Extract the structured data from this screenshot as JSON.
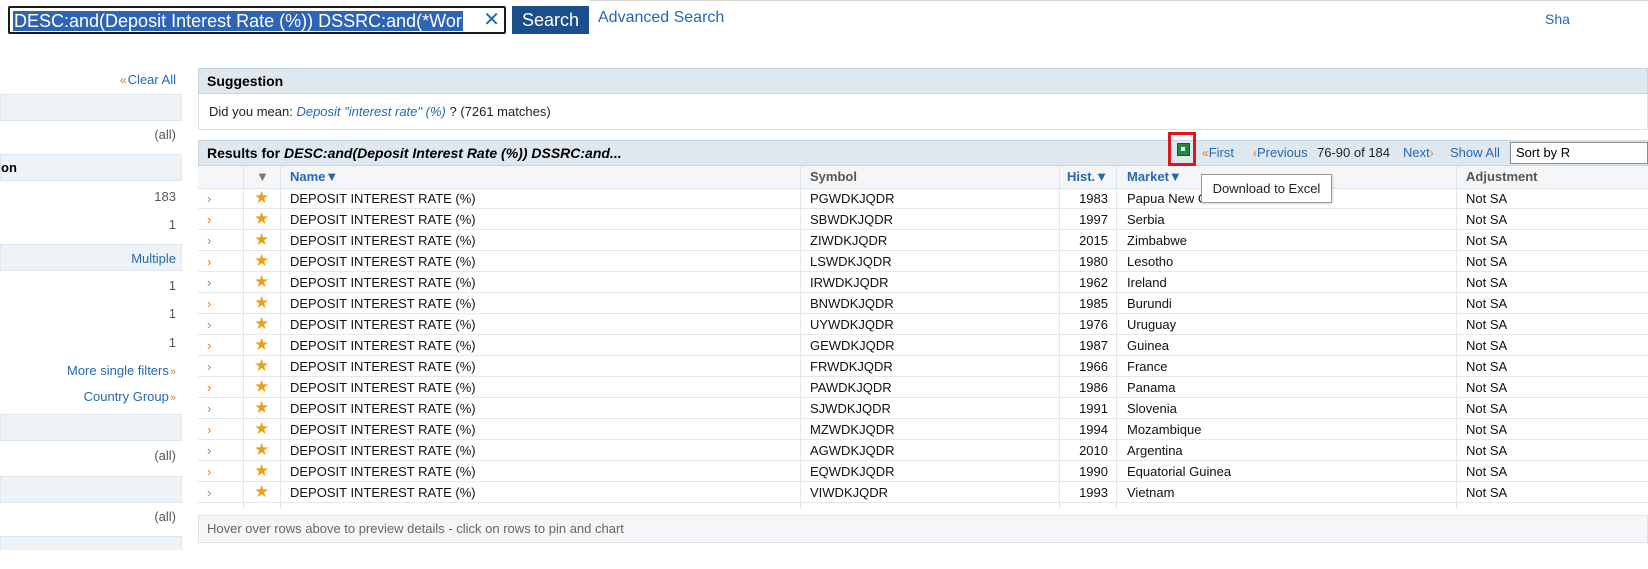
{
  "search": {
    "query": "DESC:and(Deposit Interest Rate (%)) DSSRC:and(*Wor",
    "button_label": "Search",
    "advanced_label": "Advanced Search",
    "share_label": "Sha"
  },
  "sidebar": {
    "clear_all": "Clear All",
    "section_on_label": "on",
    "values": [
      "(all)",
      "183",
      "1",
      "Multiple",
      "1",
      "1",
      "1",
      "(all)",
      "(all)"
    ],
    "more_filters": "More single filters",
    "country_group": "Country Group"
  },
  "suggestion": {
    "title": "Suggestion",
    "prefix": "Did you mean:",
    "link_text": "Deposit \"interest rate\" (%)",
    "suffix": "? (7261 matches)"
  },
  "results": {
    "label": "Results for",
    "query": "DESC:and(Deposit Interest Rate (%)) DSSRC:and...",
    "pager": {
      "first": "First",
      "previous": "Previous",
      "range": "76-90 of 184",
      "next": "Next",
      "show_all": "Show All",
      "sort_label": "Sort by R"
    },
    "tooltip": "Download to Excel",
    "columns": {
      "name": "Name",
      "symbol": "Symbol",
      "hist": "Hist.",
      "market": "Market",
      "adjustment": "Adjustment"
    },
    "rows": [
      {
        "name": "DEPOSIT INTEREST RATE (%)",
        "symbol": "PGWDKJQDR",
        "hist": "1983",
        "market": "Papua New Guinea",
        "adj": "Not SA"
      },
      {
        "name": "DEPOSIT INTEREST RATE (%)",
        "symbol": "SBWDKJQDR",
        "hist": "1997",
        "market": "Serbia",
        "adj": "Not SA"
      },
      {
        "name": "DEPOSIT INTEREST RATE (%)",
        "symbol": "ZIWDKJQDR",
        "hist": "2015",
        "market": "Zimbabwe",
        "adj": "Not SA"
      },
      {
        "name": "DEPOSIT INTEREST RATE (%)",
        "symbol": "LSWDKJQDR",
        "hist": "1980",
        "market": "Lesotho",
        "adj": "Not SA"
      },
      {
        "name": "DEPOSIT INTEREST RATE (%)",
        "symbol": "IRWDKJQDR",
        "hist": "1962",
        "market": "Ireland",
        "adj": "Not SA"
      },
      {
        "name": "DEPOSIT INTEREST RATE (%)",
        "symbol": "BNWDKJQDR",
        "hist": "1985",
        "market": "Burundi",
        "adj": "Not SA"
      },
      {
        "name": "DEPOSIT INTEREST RATE (%)",
        "symbol": "UYWDKJQDR",
        "hist": "1976",
        "market": "Uruguay",
        "adj": "Not SA"
      },
      {
        "name": "DEPOSIT INTEREST RATE (%)",
        "symbol": "GEWDKJQDR",
        "hist": "1987",
        "market": "Guinea",
        "adj": "Not SA"
      },
      {
        "name": "DEPOSIT INTEREST RATE (%)",
        "symbol": "FRWDKJQDR",
        "hist": "1966",
        "market": "France",
        "adj": "Not SA"
      },
      {
        "name": "DEPOSIT INTEREST RATE (%)",
        "symbol": "PAWDKJQDR",
        "hist": "1986",
        "market": "Panama",
        "adj": "Not SA"
      },
      {
        "name": "DEPOSIT INTEREST RATE (%)",
        "symbol": "SJWDKJQDR",
        "hist": "1991",
        "market": "Slovenia",
        "adj": "Not SA"
      },
      {
        "name": "DEPOSIT INTEREST RATE (%)",
        "symbol": "MZWDKJQDR",
        "hist": "1994",
        "market": "Mozambique",
        "adj": "Not SA"
      },
      {
        "name": "DEPOSIT INTEREST RATE (%)",
        "symbol": "AGWDKJQDR",
        "hist": "2010",
        "market": "Argentina",
        "adj": "Not SA"
      },
      {
        "name": "DEPOSIT INTEREST RATE (%)",
        "symbol": "EQWDKJQDR",
        "hist": "1990",
        "market": "Equatorial Guinea",
        "adj": "Not SA"
      },
      {
        "name": "DEPOSIT INTEREST RATE (%)",
        "symbol": "VIWDKJQDR",
        "hist": "1993",
        "market": "Vietnam",
        "adj": "Not SA"
      }
    ],
    "footer_hint": "Hover over rows above to preview details - click on rows to pin and chart"
  },
  "colors": {
    "link": "#2468b3",
    "accent_orange": "#e07a1f",
    "star": "#e8a21a",
    "header_bg": "#dfe8ef",
    "highlight_border": "#e0141e"
  }
}
